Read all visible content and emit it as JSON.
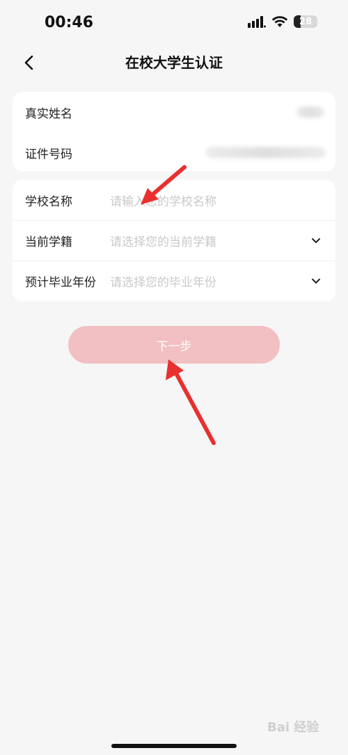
{
  "status_bar": {
    "time": "00:46",
    "battery_level": "28",
    "icons": [
      "signal-icon",
      "wifi-icon",
      "battery-icon"
    ]
  },
  "header": {
    "title": "在校大学生认证",
    "back_icon": "chevron-left-icon"
  },
  "identity_card": {
    "rows": [
      {
        "label": "真实姓名",
        "value_hidden": true
      },
      {
        "label": "证件号码",
        "value_hidden": true
      }
    ]
  },
  "school_card": {
    "rows": [
      {
        "label": "学校名称",
        "placeholder": "请输入您的学校名称",
        "type": "input"
      },
      {
        "label": "当前学籍",
        "placeholder": "请选择您的当前学籍",
        "type": "select",
        "icon": "chevron-down-icon"
      },
      {
        "label": "预计毕业年份",
        "placeholder": "请选择您的毕业年份",
        "type": "select",
        "icon": "chevron-down-icon"
      }
    ]
  },
  "next_button": {
    "label": "下一步"
  },
  "watermark": {
    "text": "Bai 经验"
  },
  "colors": {
    "background": "#f6f6f6",
    "card": "#ffffff",
    "button_disabled": "#f2c0c2",
    "placeholder": "#c9c9c9",
    "annotation_arrow": "#e8302f"
  }
}
